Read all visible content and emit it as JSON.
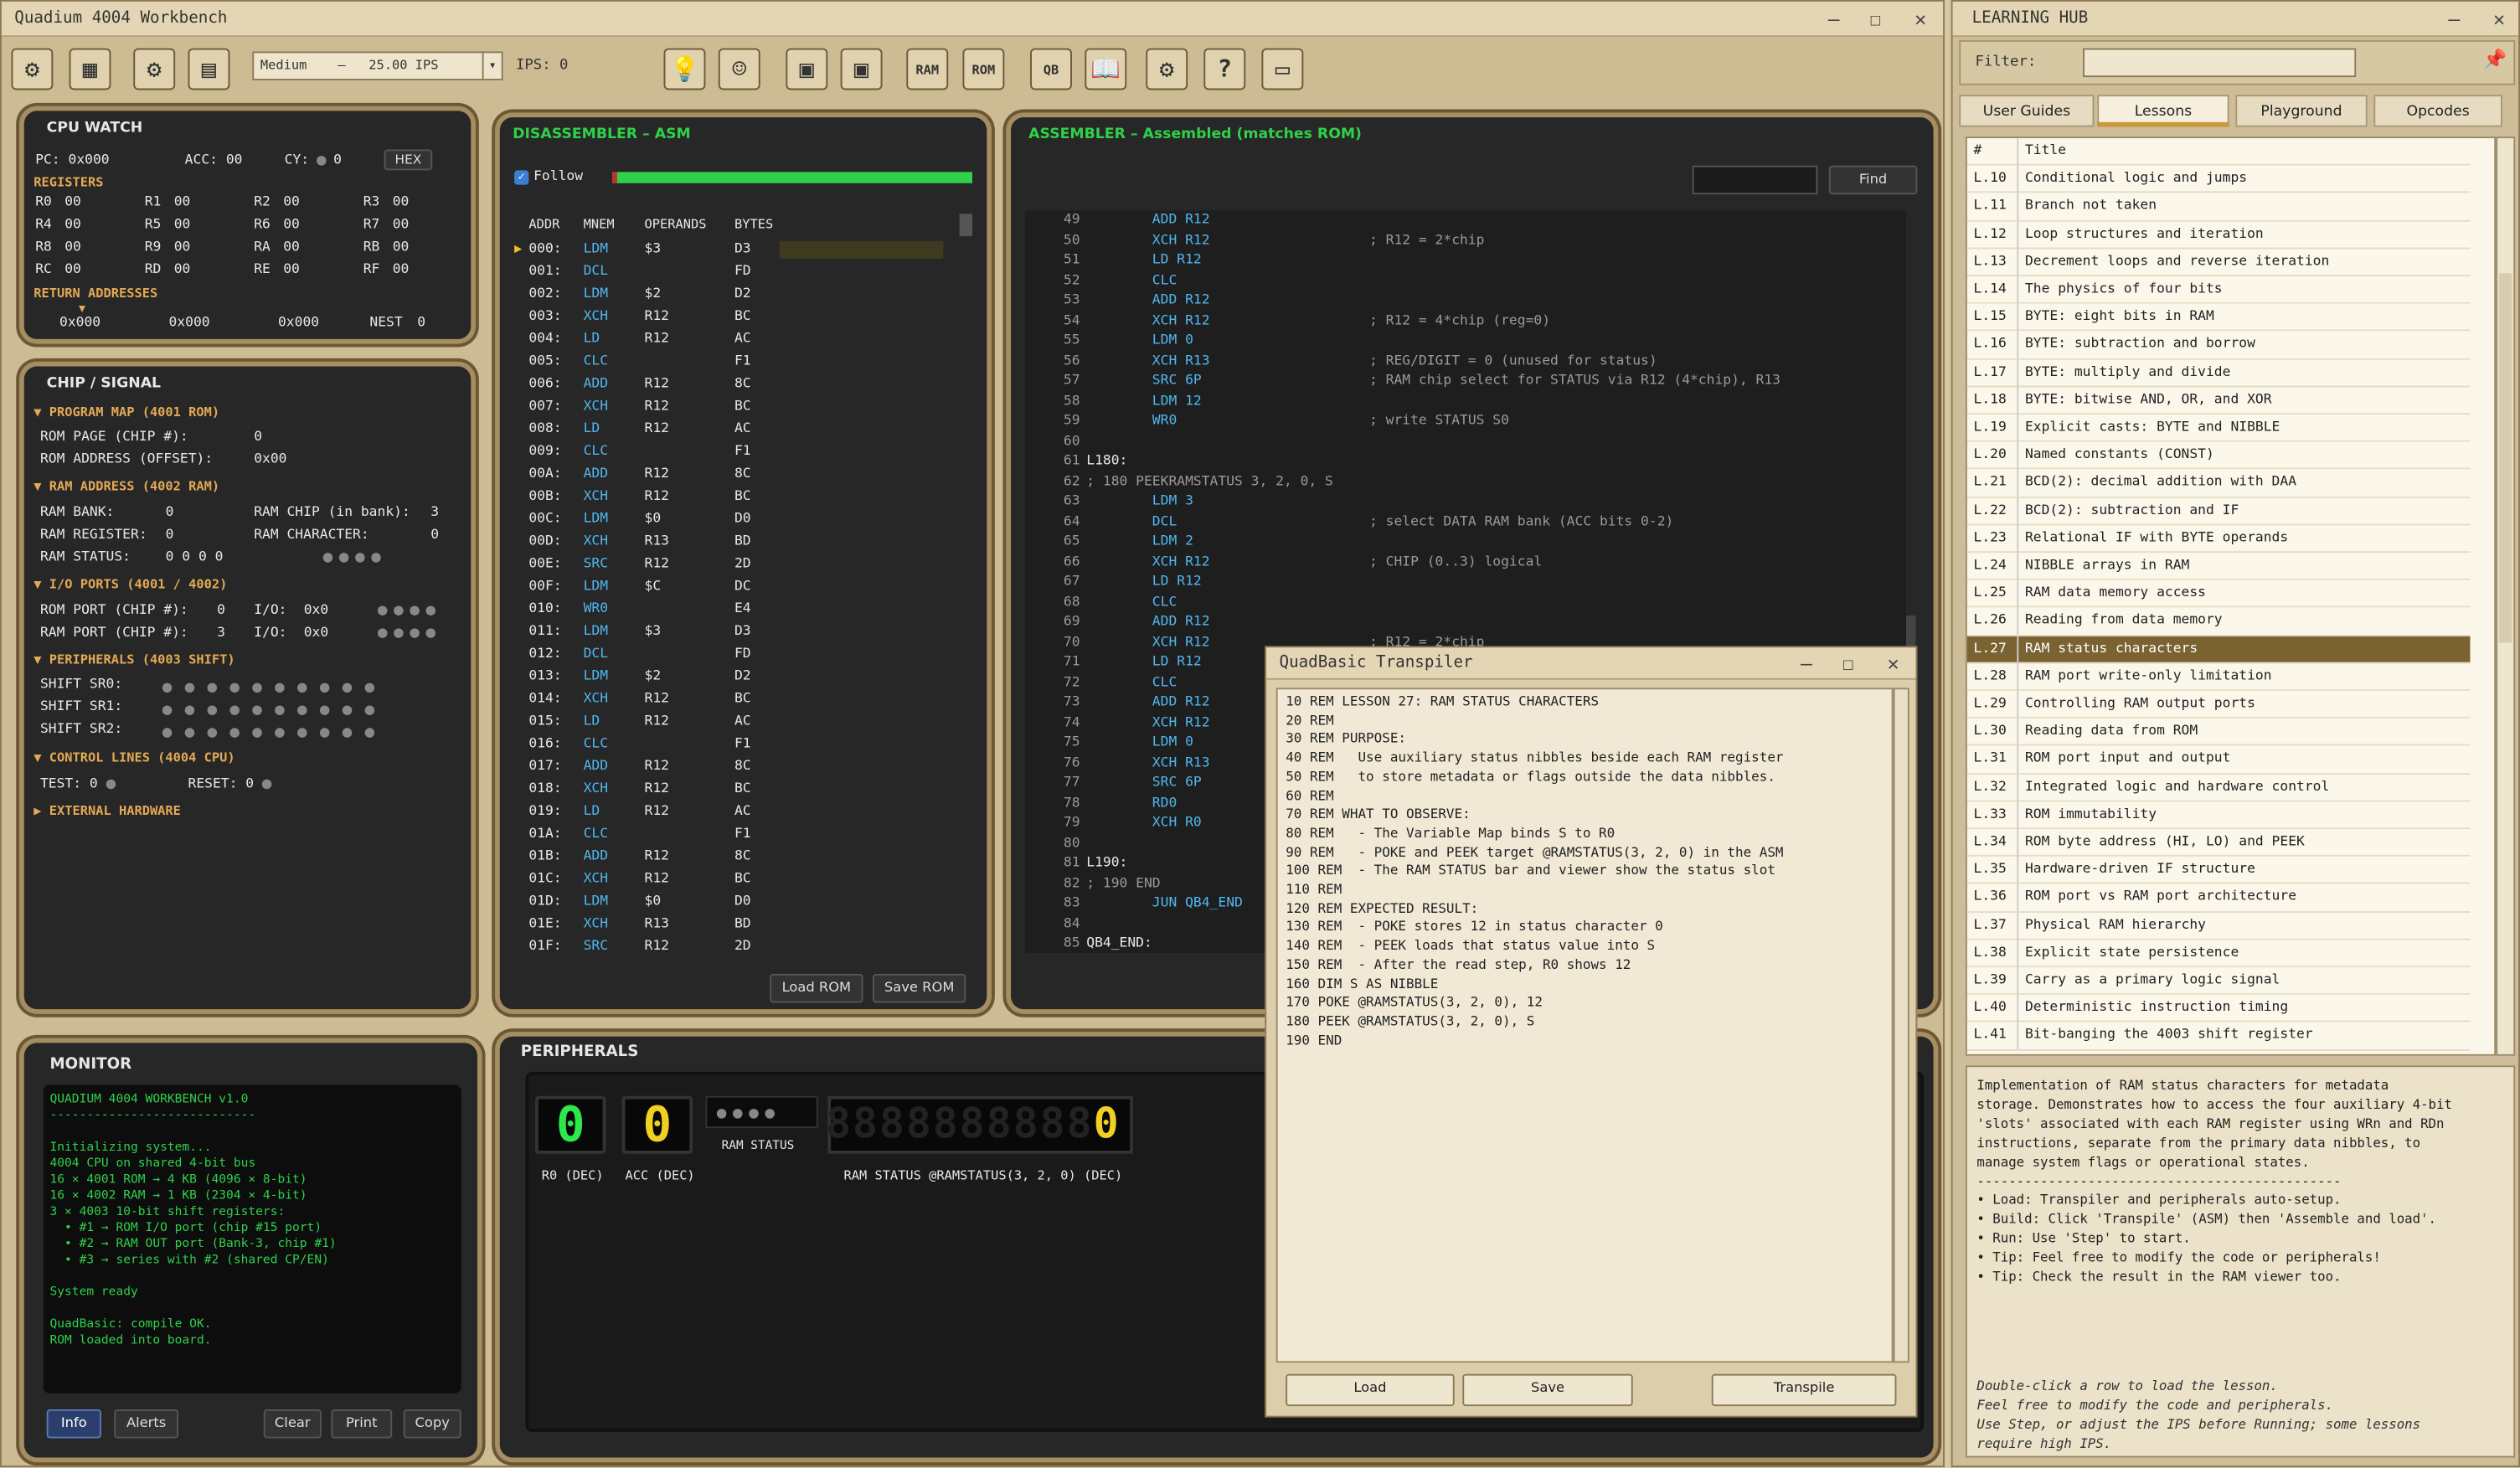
{
  "main_window": {
    "title": "Quadium 4004 Workbench",
    "speed_value": "Medium    –   25.00 IPS",
    "ips_label": "IPS: 0",
    "toolbar_icons": [
      "cpu-icon",
      "chip-icon",
      "gear-chip-icon",
      "terminal-card-icon",
      "idea-bulb-icon",
      "robot-icon",
      "image-frame-icon",
      "image-frame-2-icon",
      "ram-icon",
      "rom-icon",
      "quadbasic-icon",
      "book-icon",
      "settings-gear-icon",
      "help-monitor-icon",
      "computer-icon"
    ],
    "ram_label": "RAM",
    "rom_label": "ROM",
    "qb_label": "QB"
  },
  "cpu_watch": {
    "title": "CPU WATCH",
    "pc_label": "PC:",
    "pc": "0x000",
    "acc_label": "ACC:",
    "acc": "00",
    "cy_label": "CY:",
    "cy": "0",
    "hex_button": "HEX",
    "registers_label": "REGISTERS",
    "registers": [
      [
        "R0",
        "00"
      ],
      [
        "R1",
        "00"
      ],
      [
        "R2",
        "00"
      ],
      [
        "R3",
        "00"
      ],
      [
        "R4",
        "00"
      ],
      [
        "R5",
        "00"
      ],
      [
        "R6",
        "00"
      ],
      [
        "R7",
        "00"
      ],
      [
        "R8",
        "00"
      ],
      [
        "R9",
        "00"
      ],
      [
        "RA",
        "00"
      ],
      [
        "RB",
        "00"
      ],
      [
        "RC",
        "00"
      ],
      [
        "RD",
        "00"
      ],
      [
        "RE",
        "00"
      ],
      [
        "RF",
        "00"
      ]
    ],
    "return_label": "RETURN ADDRESSES",
    "return": [
      "0x000",
      "0x000",
      "0x000"
    ],
    "nest_label": "NEST",
    "nest": "0"
  },
  "chip_signal": {
    "title": "CHIP / SIGNAL",
    "program_map": "▼ PROGRAM MAP (4001 ROM)",
    "rom_page_label": "ROM PAGE (CHIP #):",
    "rom_page": "0",
    "rom_addr_label": "ROM ADDRESS (OFFSET):",
    "rom_addr": "0x00",
    "ram_address": "▼ RAM ADDRESS (4002 RAM)",
    "ram_bank_label": "RAM BANK:",
    "ram_bank": "0",
    "ram_chip_label": "RAM CHIP (in bank):",
    "ram_chip": "3",
    "ram_reg_label": "RAM REGISTER:",
    "ram_reg": "0",
    "ram_char_label": "RAM CHARACTER:",
    "ram_char": "0",
    "ram_status_label": "RAM STATUS:",
    "ram_status": "0 0 0 0",
    "io_ports": "▼ I/O PORTS (4001 / 4002)",
    "rom_port_label": "ROM PORT (CHIP #):",
    "rom_port": "0",
    "io_label": "I/O:",
    "rom_io": "0x0",
    "ram_port_label": "RAM PORT (CHIP #):",
    "ram_port": "3",
    "ram_io": "0x0",
    "peripherals": "▼ PERIPHERALS (4003 SHIFT)",
    "sr0": "SHIFT SR0:",
    "sr1": "SHIFT SR1:",
    "sr2": "SHIFT SR2:",
    "control": "▼ CONTROL LINES (4004 CPU)",
    "test_label": "TEST:",
    "test": "0",
    "reset_label": "RESET:",
    "reset": "0",
    "external": "▶ EXTERNAL HARDWARE"
  },
  "disassembler": {
    "title": "DISASSEMBLER – ASM",
    "follow": "Follow",
    "headers": [
      "ADDR",
      "MNEM",
      "OPERANDS",
      "BYTES"
    ],
    "rows": [
      [
        "000:",
        "LDM",
        "$3",
        "D3"
      ],
      [
        "001:",
        "DCL",
        "",
        "FD"
      ],
      [
        "002:",
        "LDM",
        "$2",
        "D2"
      ],
      [
        "003:",
        "XCH",
        "R12",
        "BC"
      ],
      [
        "004:",
        "LD",
        "R12",
        "AC"
      ],
      [
        "005:",
        "CLC",
        "",
        "F1"
      ],
      [
        "006:",
        "ADD",
        "R12",
        "8C"
      ],
      [
        "007:",
        "XCH",
        "R12",
        "BC"
      ],
      [
        "008:",
        "LD",
        "R12",
        "AC"
      ],
      [
        "009:",
        "CLC",
        "",
        "F1"
      ],
      [
        "00A:",
        "ADD",
        "R12",
        "8C"
      ],
      [
        "00B:",
        "XCH",
        "R12",
        "BC"
      ],
      [
        "00C:",
        "LDM",
        "$0",
        "D0"
      ],
      [
        "00D:",
        "XCH",
        "R13",
        "BD"
      ],
      [
        "00E:",
        "SRC",
        "R12",
        "2D"
      ],
      [
        "00F:",
        "LDM",
        "$C",
        "DC"
      ],
      [
        "010:",
        "WR0",
        "",
        "E4"
      ],
      [
        "011:",
        "LDM",
        "$3",
        "D3"
      ],
      [
        "012:",
        "DCL",
        "",
        "FD"
      ],
      [
        "013:",
        "LDM",
        "$2",
        "D2"
      ],
      [
        "014:",
        "XCH",
        "R12",
        "BC"
      ],
      [
        "015:",
        "LD",
        "R12",
        "AC"
      ],
      [
        "016:",
        "CLC",
        "",
        "F1"
      ],
      [
        "017:",
        "ADD",
        "R12",
        "8C"
      ],
      [
        "018:",
        "XCH",
        "R12",
        "BC"
      ],
      [
        "019:",
        "LD",
        "R12",
        "AC"
      ],
      [
        "01A:",
        "CLC",
        "",
        "F1"
      ],
      [
        "01B:",
        "ADD",
        "R12",
        "8C"
      ],
      [
        "01C:",
        "XCH",
        "R12",
        "BC"
      ],
      [
        "01D:",
        "LDM",
        "$0",
        "D0"
      ],
      [
        "01E:",
        "XCH",
        "R13",
        "BD"
      ],
      [
        "01F:",
        "SRC",
        "R12",
        "2D"
      ]
    ],
    "load_rom": "Load ROM",
    "save_rom": "Save ROM"
  },
  "assembler": {
    "title": "ASSEMBLER – Assembled (matches ROM)",
    "find": "Find",
    "lines": [
      [
        "49",
        "        ADD R12",
        ""
      ],
      [
        "50",
        "        XCH R12",
        "; R12 = 2*chip"
      ],
      [
        "51",
        "        LD R12",
        ""
      ],
      [
        "52",
        "        CLC",
        ""
      ],
      [
        "53",
        "        ADD R12",
        ""
      ],
      [
        "54",
        "        XCH R12",
        "; R12 = 4*chip (reg=0)"
      ],
      [
        "55",
        "        LDM 0",
        ""
      ],
      [
        "56",
        "        XCH R13",
        "; REG/DIGIT = 0 (unused for status)"
      ],
      [
        "57",
        "        SRC 6P",
        "; RAM chip select for STATUS via R12 (4*chip), R13"
      ],
      [
        "58",
        "        LDM 12",
        ""
      ],
      [
        "59",
        "        WR0",
        "; write STATUS S0"
      ],
      [
        "60",
        "",
        ""
      ],
      [
        "61",
        "L180:",
        ""
      ],
      [
        "62",
        "; 180 PEEKRAMSTATUS 3, 2, 0, S",
        ""
      ],
      [
        "63",
        "        LDM 3",
        ""
      ],
      [
        "64",
        "        DCL",
        "; select DATA RAM bank (ACC bits 0-2)"
      ],
      [
        "65",
        "        LDM 2",
        ""
      ],
      [
        "66",
        "        XCH R12",
        "; CHIP (0..3) logical"
      ],
      [
        "67",
        "        LD R12",
        ""
      ],
      [
        "68",
        "        CLC",
        ""
      ],
      [
        "69",
        "        ADD R12",
        ""
      ],
      [
        "70",
        "        XCH R12",
        "; R12 = 2*chip"
      ],
      [
        "71",
        "        LD R12",
        ""
      ],
      [
        "72",
        "        CLC",
        ""
      ],
      [
        "73",
        "        ADD R12",
        ""
      ],
      [
        "74",
        "        XCH R12",
        ""
      ],
      [
        "75",
        "        LDM 0",
        ""
      ],
      [
        "76",
        "        XCH R13",
        ""
      ],
      [
        "77",
        "        SRC 6P",
        ""
      ],
      [
        "78",
        "        RD0",
        ""
      ],
      [
        "79",
        "        XCH R0",
        ""
      ],
      [
        "80",
        "",
        ""
      ],
      [
        "81",
        "L190:",
        ""
      ],
      [
        "82",
        "; 190 END",
        ""
      ],
      [
        "83",
        "        JUN QB4_END",
        ""
      ],
      [
        "84",
        "",
        ""
      ],
      [
        "85",
        "QB4_END:",
        ""
      ]
    ]
  },
  "monitor": {
    "title": "MONITOR",
    "lines": [
      "QUADIUM 4004 WORKBENCH v1.0",
      "----------------------------",
      "",
      "Initializing system...",
      "4004 CPU on shared 4-bit bus",
      "16 × 4001 ROM → 4 KB (4096 × 8-bit)",
      "16 × 4002 RAM → 1 KB (2304 × 4-bit)",
      "3 × 4003 10-bit shift registers:",
      "  • #1 → ROM I/O port (chip #15 port)",
      "  • #2 → RAM OUT port (Bank-3, chip #1)",
      "  • #3 → series with #2 (shared CP/EN)",
      "",
      "System ready",
      "",
      "QuadBasic: compile OK.",
      "ROM loaded into board."
    ],
    "buttons": [
      "Info",
      "Alerts",
      "Clear",
      "Print",
      "Copy"
    ]
  },
  "peripherals": {
    "title": "PERIPHERALS",
    "r0_label": "R0 (DEC)",
    "acc_label": "ACC (DEC)",
    "ram_status_label": "RAM STATUS",
    "ramstatus_label": "RAM STATUS @RAMSTATUS(3, 2, 0) (DEC)",
    "r0_digit": "0",
    "acc_digit": "0",
    "status_digit": "0"
  },
  "transpiler": {
    "title": "QuadBasic Transpiler",
    "lines": [
      "10 REM LESSON 27: RAM STATUS CHARACTERS",
      "20 REM",
      "30 REM PURPOSE:",
      "40 REM   Use auxiliary status nibbles beside each RAM register",
      "50 REM   to store metadata or flags outside the data nibbles.",
      "60 REM",
      "70 REM WHAT TO OBSERVE:",
      "80 REM   - The Variable Map binds S to R0",
      "90 REM   - POKE and PEEK target @RAMSTATUS(3, 2, 0) in the ASM",
      "100 REM  - The RAM STATUS bar and viewer show the status slot",
      "110 REM",
      "120 REM EXPECTED RESULT:",
      "130 REM  - POKE stores 12 in status character 0",
      "140 REM  - PEEK loads that status value into S",
      "150 REM  - After the read step, R0 shows 12",
      "160 DIM S AS NIBBLE",
      "170 POKE @RAMSTATUS(3, 2, 0), 12",
      "180 PEEK @RAMSTATUS(3, 2, 0), S",
      "190 END"
    ],
    "load": "Load",
    "save": "Save",
    "transpile": "Transpile"
  },
  "learning_hub": {
    "title": "LEARNING HUB",
    "filter_label": "Filter:",
    "tabs": [
      "User Guides",
      "Lessons",
      "Playground",
      "Opcodes"
    ],
    "col_num": "#",
    "col_title": "Title",
    "rows": [
      [
        "L.10",
        "Conditional logic and jumps"
      ],
      [
        "L.11",
        "Branch not taken"
      ],
      [
        "L.12",
        "Loop structures and iteration"
      ],
      [
        "L.13",
        "Decrement loops and reverse iteration"
      ],
      [
        "L.14",
        "The physics of four bits"
      ],
      [
        "L.15",
        "BYTE: eight bits in RAM"
      ],
      [
        "L.16",
        "BYTE: subtraction and borrow"
      ],
      [
        "L.17",
        "BYTE: multiply and divide"
      ],
      [
        "L.18",
        "BYTE: bitwise AND, OR, and XOR"
      ],
      [
        "L.19",
        "Explicit casts: BYTE and NIBBLE"
      ],
      [
        "L.20",
        "Named constants (CONST)"
      ],
      [
        "L.21",
        "BCD(2): decimal addition with DAA"
      ],
      [
        "L.22",
        "BCD(2): subtraction and IF"
      ],
      [
        "L.23",
        "Relational IF with BYTE operands"
      ],
      [
        "L.24",
        "NIBBLE arrays in RAM"
      ],
      [
        "L.25",
        "RAM data memory access"
      ],
      [
        "L.26",
        "Reading from data memory"
      ],
      [
        "L.27",
        "RAM status characters"
      ],
      [
        "L.28",
        "RAM port write-only limitation"
      ],
      [
        "L.29",
        "Controlling RAM output ports"
      ],
      [
        "L.30",
        "Reading data from ROM"
      ],
      [
        "L.31",
        "ROM port input and output"
      ],
      [
        "L.32",
        "Integrated logic and hardware control"
      ],
      [
        "L.33",
        "ROM immutability"
      ],
      [
        "L.34",
        "ROM byte address (HI, LO) and PEEK"
      ],
      [
        "L.35",
        "Hardware-driven IF structure"
      ],
      [
        "L.36",
        "ROM port vs RAM port architecture"
      ],
      [
        "L.37",
        "Physical RAM hierarchy"
      ],
      [
        "L.38",
        "Explicit state persistence"
      ],
      [
        "L.39",
        "Carry as a primary logic signal"
      ],
      [
        "L.40",
        "Deterministic instruction timing"
      ],
      [
        "L.41",
        "Bit-banging the 4003 shift register"
      ]
    ],
    "selected": "L.27",
    "description": [
      "Implementation of RAM status characters for metadata",
      "storage. Demonstrates how to access the four auxiliary 4-bit",
      "'slots' associated with each RAM register using WRn and RDn",
      "instructions, separate from the primary data nibbles, to",
      "manage system flags or operational states.",
      "----------------------------------------------",
      "• Load: Transpiler and peripherals auto-setup.",
      "• Build: Click 'Transpile' (ASM) then 'Assemble and load'.",
      "• Run: Use 'Step' to start.",
      "• Tip: Feel free to modify the code or peripherals!",
      "• Tip: Check the result in the RAM viewer too."
    ],
    "hints": [
      "Double-click a row to load the lesson.",
      "Feel free to modify the code and peripherals.",
      "Use Step, or adjust the IPS before Running; some lessons",
      "require high IPS."
    ]
  },
  "colors": {
    "accent_green": "#2fd14a",
    "mnemonic_blue": "#4fb8f0",
    "selection": "#7a6231",
    "segment_yellow": "#f0d020",
    "segment_green": "#2ee84a"
  }
}
